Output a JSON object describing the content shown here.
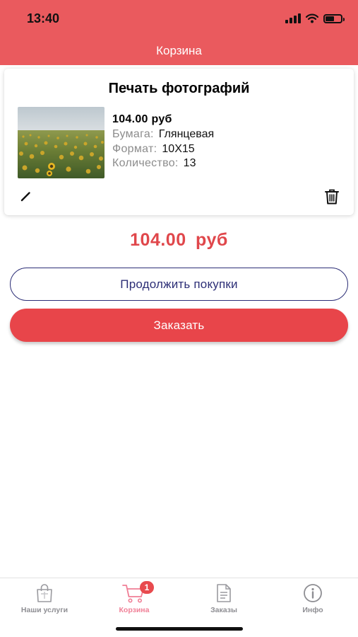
{
  "status_bar": {
    "time": "13:40"
  },
  "header": {
    "title": "Корзина"
  },
  "cart_item": {
    "title": "Печать фотографий",
    "price": "104.00 руб",
    "details": [
      {
        "label": "Бумага:",
        "value": "Глянцевая"
      },
      {
        "label": "Формат:",
        "value": "10X15"
      },
      {
        "label": "Количество:",
        "value": "13"
      }
    ],
    "photo_icon": "sunflower-field-photo",
    "edit_icon": "pencil-icon",
    "delete_icon": "trash-icon"
  },
  "total": "104.00 руб",
  "buttons": {
    "continue_label": "Продолжить покупки",
    "order_label": "Заказать"
  },
  "tab_bar": {
    "tabs": [
      {
        "label": "Наши услуги",
        "icon": "shopping-bag-icon",
        "active": false
      },
      {
        "label": "Корзина",
        "icon": "cart-icon",
        "active": true,
        "badge": "1"
      },
      {
        "label": "Заказы",
        "icon": "document-icon",
        "active": false
      },
      {
        "label": "Инфо",
        "icon": "info-icon",
        "active": false
      }
    ]
  },
  "colors": {
    "header": "#ea5a5e",
    "accent": "#e8454a",
    "outline_button": "#2c2e76",
    "active_tab": "#f07f96",
    "inactive_tab": "#8e8e93"
  }
}
